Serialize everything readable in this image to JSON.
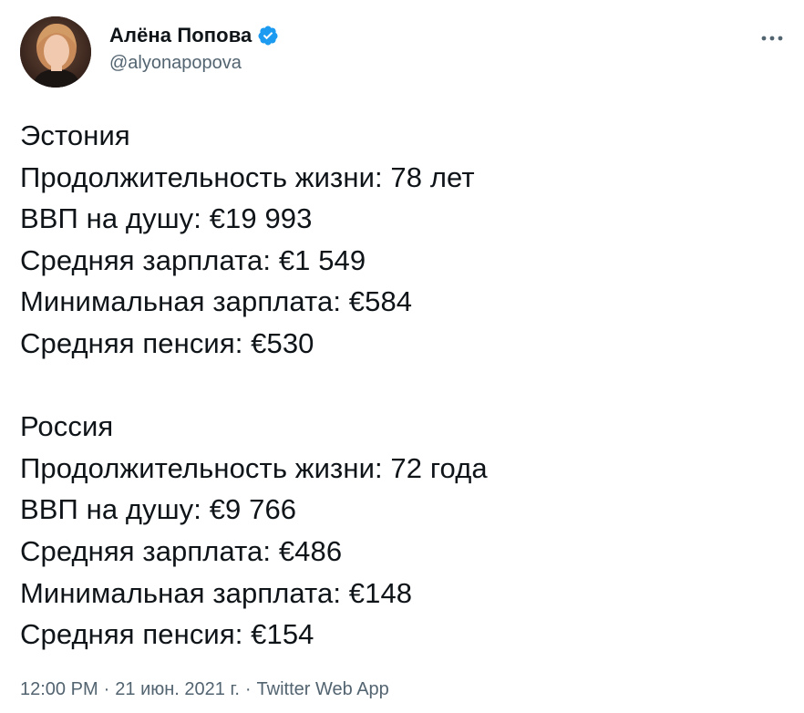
{
  "author": {
    "display_name": "Алёна Попова",
    "handle": "@alyonapopova",
    "verified": true
  },
  "tweet": {
    "sections": [
      {
        "title": "Эстония",
        "lines": [
          "Продолжительность жизни: 78 лет",
          "ВВП на душу: €19 993",
          "Средняя зарплата: €1 549",
          "Минимальная зарплата: €584",
          "Средняя пенсия: €530"
        ]
      },
      {
        "title": "Россия",
        "lines": [
          "Продолжительность жизни: 72 года",
          "ВВП на душу: €9 766",
          "Средняя зарплата: €486",
          "Минимальная зарплата: €148",
          "Средняя пенсия: €154"
        ]
      }
    ]
  },
  "meta": {
    "time": "12:00 PM",
    "date": "21 июн. 2021 г.",
    "source": "Twitter Web App",
    "separator": "·"
  },
  "icons": {
    "verified": "verified-badge-icon",
    "more": "more-options-icon"
  },
  "colors": {
    "verified_blue": "#1d9bf0",
    "text_primary": "#0f1419",
    "text_secondary": "#536471"
  }
}
